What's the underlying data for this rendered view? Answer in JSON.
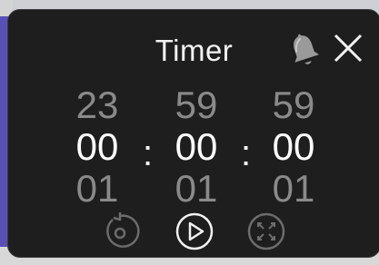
{
  "dialog": {
    "title": "Timer",
    "bell_icon": "bell-icon",
    "close_icon": "close-icon"
  },
  "picker": {
    "hours": {
      "above": "23",
      "selected": "00",
      "below": "01"
    },
    "minutes": {
      "above": "59",
      "selected": "00",
      "below": "01"
    },
    "seconds": {
      "above": "59",
      "selected": "00",
      "below": "01"
    },
    "separator": ":"
  },
  "controls": {
    "reset_icon": "reset-icon",
    "play_icon": "play-icon",
    "expand_icon": "expand-icon"
  },
  "colors": {
    "panel_bg": "#1e1e1e",
    "dim_digits": "#8a8a8a",
    "bright_digits": "#ffffff",
    "accent_edge": "#5a4fb8"
  }
}
